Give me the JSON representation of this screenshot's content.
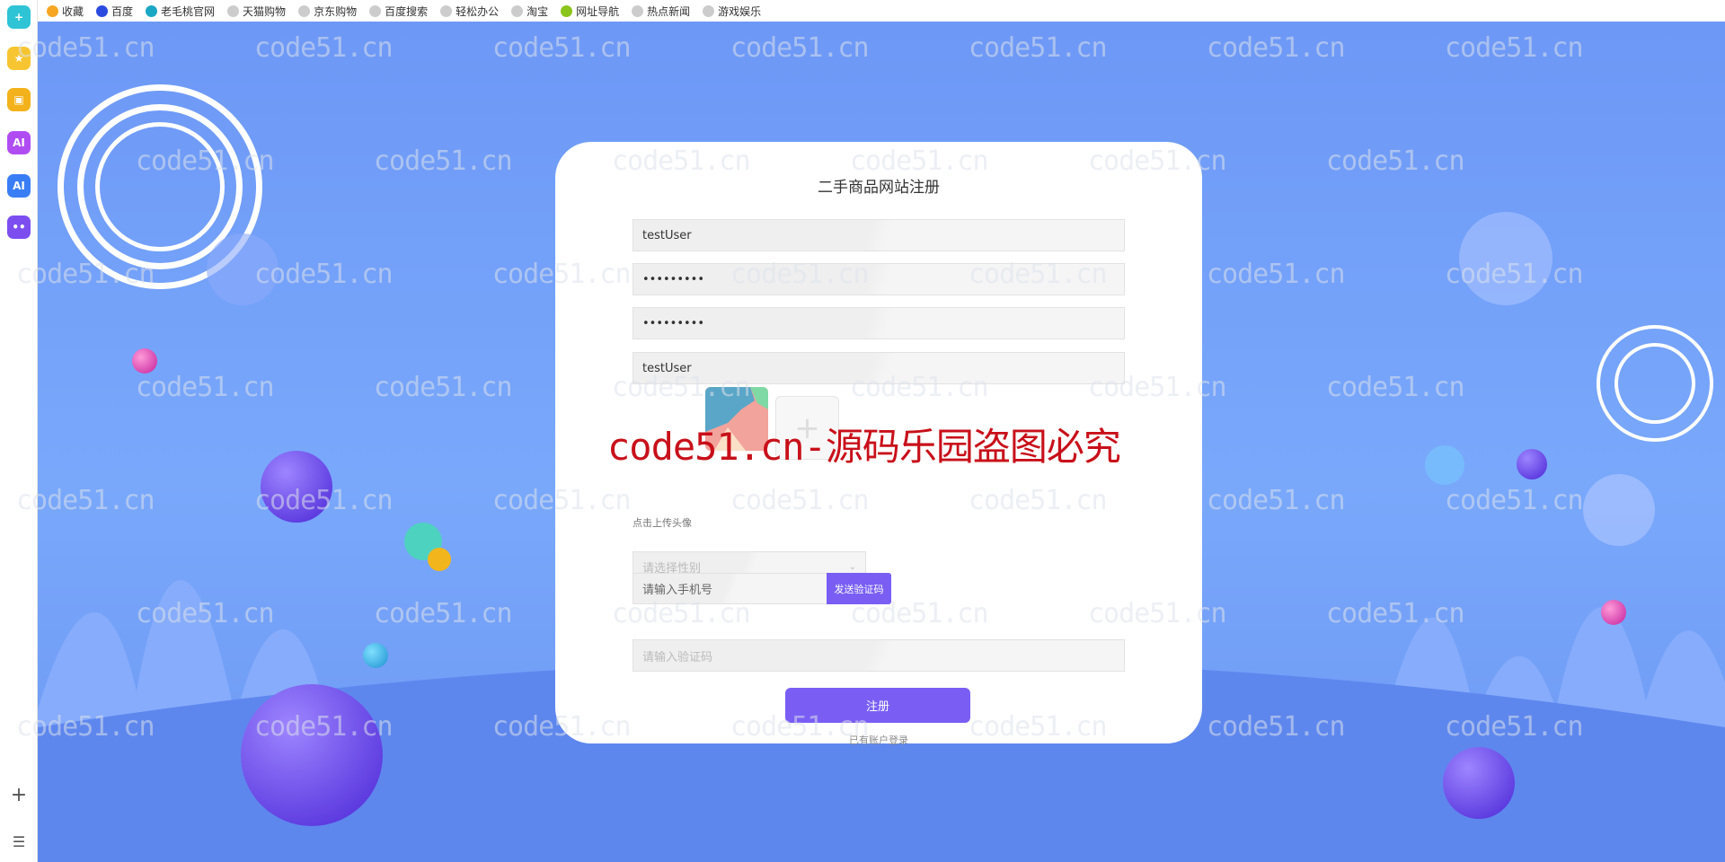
{
  "bookmarks": [
    "收藏",
    "百度",
    "老毛桃官网",
    "天猫购物",
    "京东购物",
    "百度搜索",
    "轻松办公",
    "淘宝",
    "网址导航",
    "热点新闻",
    "游戏娱乐"
  ],
  "watermark": "code51.cn",
  "red_watermark": "code51.cn-源码乐园盗图必究",
  "form": {
    "title": "二手商品网站注册",
    "username": "testUser",
    "password": "•••••••••",
    "confirm_password": "•••••••••",
    "nickname": "testUser",
    "upload_plus": "+",
    "upload_hint": "点击上传头像",
    "gender_placeholder": "请选择性别",
    "phone_placeholder": "请输入手机号",
    "send_code": "发送验证码",
    "code_placeholder": "请输入验证码",
    "register": "注册",
    "login_link": "已有账户登录"
  },
  "colors": {
    "accent": "#7a5ef4",
    "background": "#6d98f6",
    "watermark_red": "#c8101a"
  }
}
